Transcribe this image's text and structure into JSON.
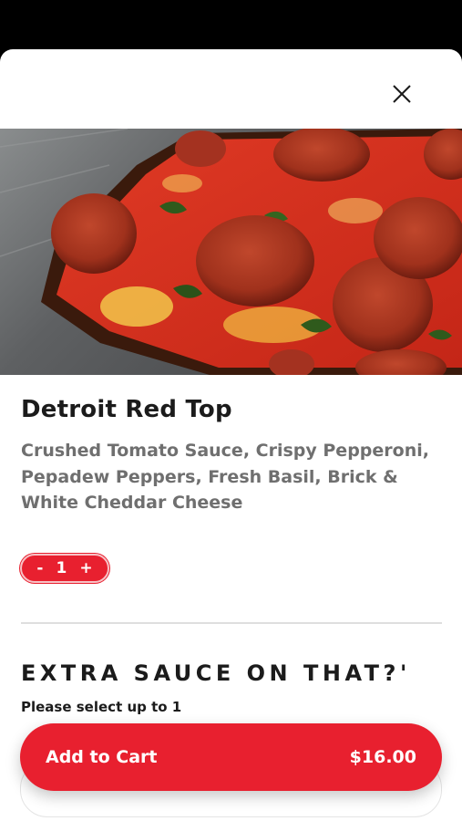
{
  "item": {
    "title": "Detroit Red Top",
    "description": "Crushed Tomato Sauce, Crispy Pepperoni, Pepadew Peppers, Fresh Basil, Brick & White Cheddar Cheese",
    "image_icon": "pizza-photo"
  },
  "quantity": {
    "minus": "-",
    "value": "1",
    "plus": "+"
  },
  "section": {
    "title": "EXTRA SAUCE ON THAT?'",
    "subtitle": "Please select up to 1"
  },
  "cart": {
    "label": "Add to Cart",
    "price": "$16.00"
  },
  "icons": {
    "close": "close-icon"
  },
  "colors": {
    "accent": "#e8202f",
    "text": "#1b1b1b",
    "muted": "#6f6f6f"
  }
}
